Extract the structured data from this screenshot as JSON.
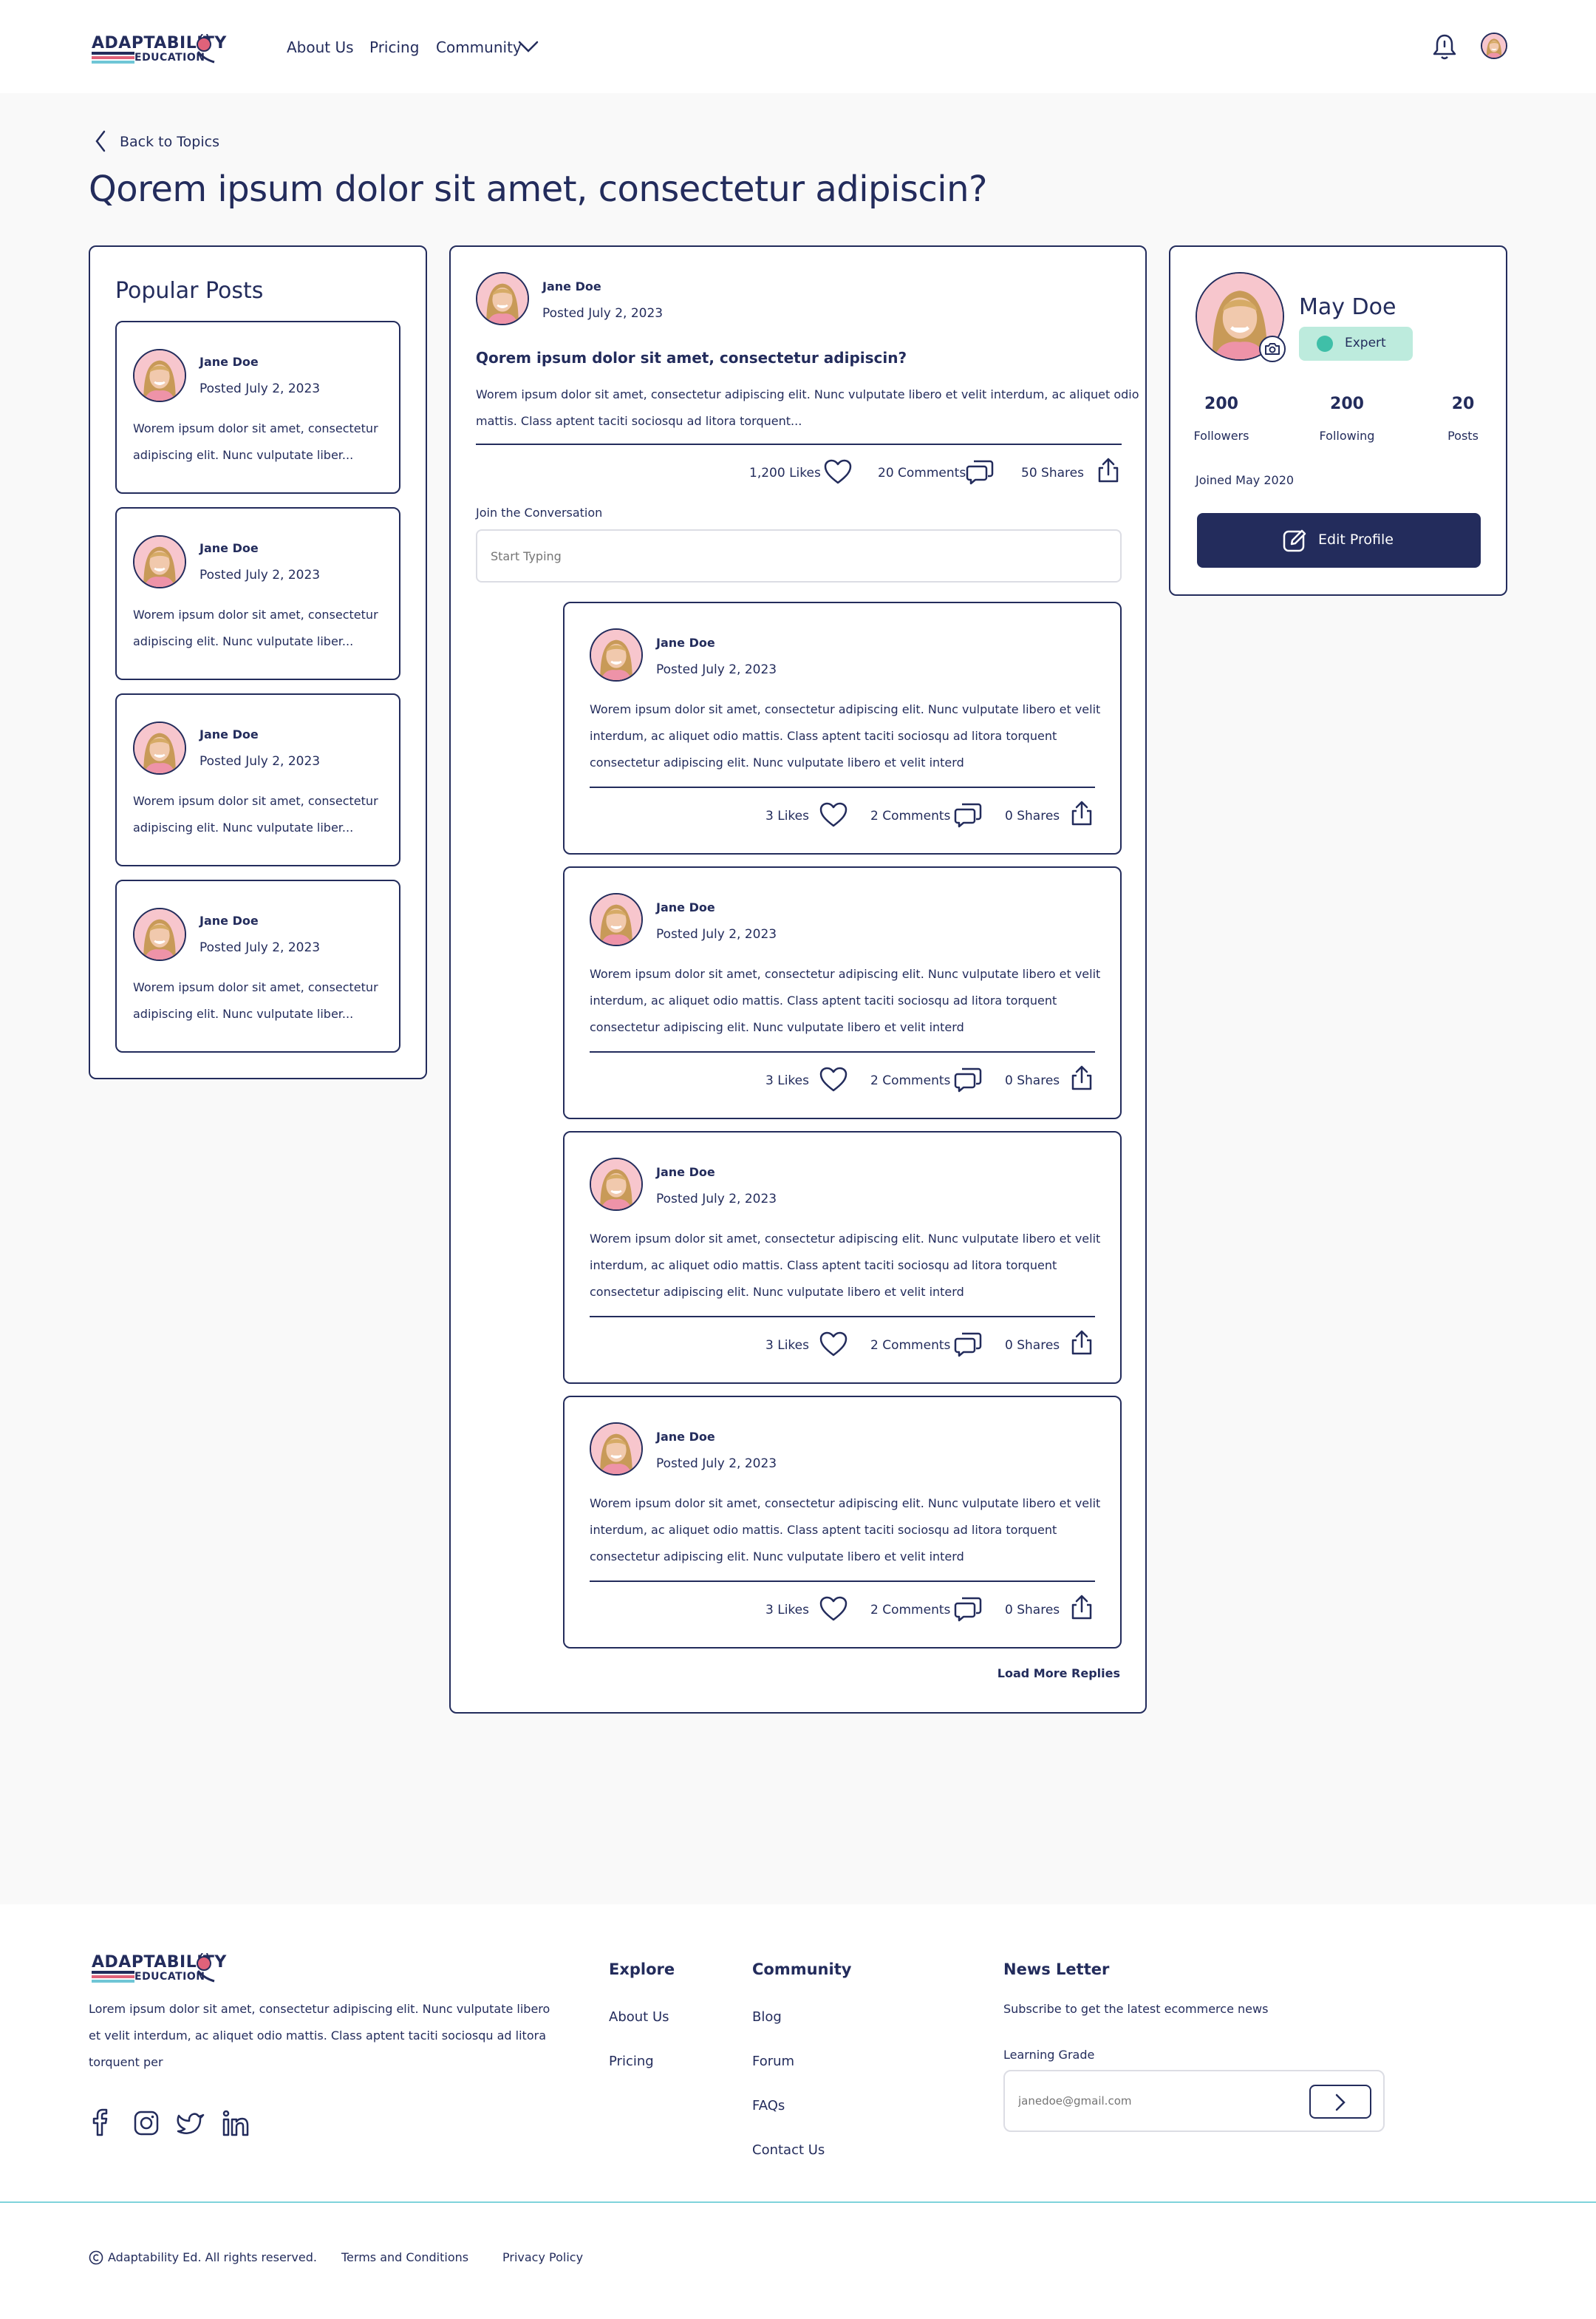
{
  "brand": {
    "line1": "ADAPTABILITY",
    "line2": "EDUCATION"
  },
  "nav": {
    "about": "About Us",
    "pricing": "Pricing",
    "community": "Community"
  },
  "page": {
    "back": "Back to Topics",
    "title": "Qorem ipsum dolor sit amet, consectetur adipiscin?"
  },
  "popular": {
    "title": "Popular Posts",
    "posts": [
      {
        "name": "Jane Doe",
        "date": "Posted July 2, 2023",
        "line1": "Worem ipsum dolor sit amet, consectetur",
        "line2": "adipiscing elit. Nunc vulputate liber..."
      },
      {
        "name": "Jane Doe",
        "date": "Posted July 2, 2023",
        "line1": "Worem ipsum dolor sit amet, consectetur",
        "line2": "adipiscing elit. Nunc vulputate liber..."
      },
      {
        "name": "Jane Doe",
        "date": "Posted July 2, 2023",
        "line1": "Worem ipsum dolor sit amet, consectetur",
        "line2": "adipiscing elit. Nunc vulputate liber..."
      },
      {
        "name": "Jane Doe",
        "date": "Posted July 2, 2023",
        "line1": "Worem ipsum dolor sit amet, consectetur",
        "line2": "adipiscing elit. Nunc vulputate liber..."
      }
    ]
  },
  "main_post": {
    "name": "Jane Doe",
    "date": "Posted July 2, 2023",
    "title": "Qorem ipsum dolor sit amet, consectetur adipiscin?",
    "line1": "Worem ipsum dolor sit amet, consectetur adipiscing elit. Nunc vulputate libero et velit interdum, ac aliquet odio",
    "line2": "mattis. Class aptent taciti sociosqu ad litora torquent...",
    "likes": "1,200 Likes",
    "comments": "20 Comments",
    "shares": "50 Shares"
  },
  "conversation": {
    "label": "Join the Conversation",
    "placeholder": "Start Typing"
  },
  "replies": [
    {
      "name": "Jane Doe",
      "date": "Posted July 2, 2023",
      "line1": "Worem ipsum dolor sit amet, consectetur adipiscing elit. Nunc vulputate libero et velit",
      "line2": "interdum, ac aliquet odio mattis. Class aptent taciti sociosqu ad litora torquent",
      "line3": "consectetur adipiscing elit. Nunc vulputate libero et velit interd",
      "likes": "3 Likes",
      "comments": "2 Comments",
      "shares": "0 Shares"
    },
    {
      "name": "Jane Doe",
      "date": "Posted July 2, 2023",
      "line1": "Worem ipsum dolor sit amet, consectetur adipiscing elit. Nunc vulputate libero et velit",
      "line2": "interdum, ac aliquet odio mattis. Class aptent taciti sociosqu ad litora torquent",
      "line3": "consectetur adipiscing elit. Nunc vulputate libero et velit interd",
      "likes": "3 Likes",
      "comments": "2 Comments",
      "shares": "0 Shares"
    },
    {
      "name": "Jane Doe",
      "date": "Posted July 2, 2023",
      "line1": "Worem ipsum dolor sit amet, consectetur adipiscing elit. Nunc vulputate libero et velit",
      "line2": "interdum, ac aliquet odio mattis. Class aptent taciti sociosqu ad litora torquent",
      "line3": "consectetur adipiscing elit. Nunc vulputate libero et velit interd",
      "likes": "3 Likes",
      "comments": "2 Comments",
      "shares": "0 Shares"
    },
    {
      "name": "Jane Doe",
      "date": "Posted July 2, 2023",
      "line1": "Worem ipsum dolor sit amet, consectetur adipiscing elit. Nunc vulputate libero et velit",
      "line2": "interdum, ac aliquet odio mattis. Class aptent taciti sociosqu ad litora torquent",
      "line3": "consectetur adipiscing elit. Nunc vulputate libero et velit interd",
      "likes": "3 Likes",
      "comments": "2 Comments",
      "shares": "0 Shares"
    }
  ],
  "load_more": "Load More Replies",
  "profile": {
    "name": "May Doe",
    "badge": "Expert",
    "followers_count": "200",
    "followers_label": "Followers",
    "following_count": "200",
    "following_label": "Following",
    "posts_count": "20",
    "posts_label": "Posts",
    "joined": "Joined May 2020",
    "edit": "Edit Profile"
  },
  "footer": {
    "desc1": "Lorem ipsum dolor sit amet, consectetur adipiscing elit. Nunc vulputate libero",
    "desc2": "et velit interdum, ac aliquet odio mattis. Class aptent taciti sociosqu ad litora",
    "desc3": "torquent per",
    "explore_title": "Explore",
    "explore_about": "About Us",
    "explore_pricing": "Pricing",
    "community_title": "Community",
    "community_blog": "Blog",
    "community_forum": "Forum",
    "community_faqs": "FAQs",
    "community_contact": "Contact Us",
    "newsletter_title": "News Letter",
    "newsletter_sub": "Subscribe to get the latest ecommerce news",
    "grade_label": "Learning Grade",
    "email_placeholder": "janedoe@gmail.com",
    "copyright": "Adaptability Ed. All rights reserved.",
    "terms": "Terms and Conditions",
    "privacy": "Privacy Policy"
  },
  "colors": {
    "navy": "#232c5c",
    "badge_bg": "#bdebdd",
    "badge_dot": "#3fbfa8",
    "divider_teal": "#7fd3db",
    "page_bg": "#f9f9f9"
  }
}
